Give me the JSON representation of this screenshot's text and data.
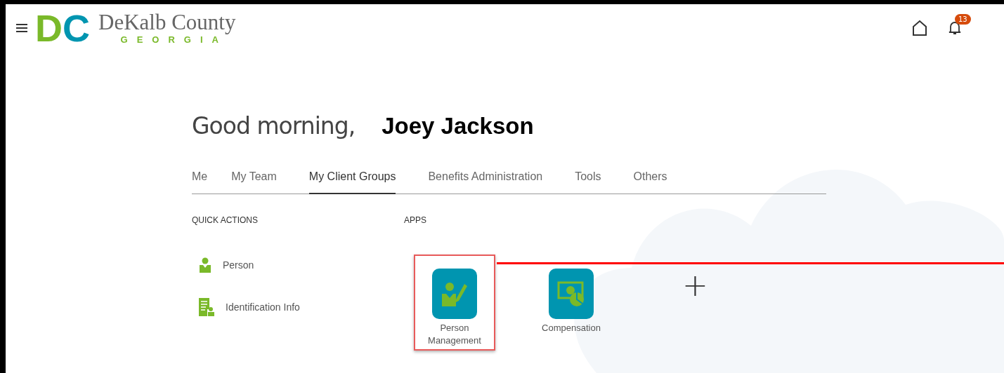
{
  "header": {
    "logo_mark": [
      "D",
      "C"
    ],
    "logo_name": "DeKalb County",
    "logo_sub": "GEORGIA",
    "notification_count": "13"
  },
  "greeting": {
    "text": "Good morning,",
    "name": "Joey Jackson"
  },
  "tabs": [
    {
      "label": "Me",
      "selected": false
    },
    {
      "label": "My Team",
      "selected": false
    },
    {
      "label": "My Client Groups",
      "selected": true
    },
    {
      "label": "Benefits Administration",
      "selected": false
    },
    {
      "label": "Tools",
      "selected": false
    },
    {
      "label": "Others",
      "selected": false
    }
  ],
  "quick_actions": {
    "title": "QUICK ACTIONS",
    "items": [
      {
        "label": "Person",
        "kind": "person"
      },
      {
        "label": "Identification Info",
        "kind": "document"
      }
    ]
  },
  "apps": {
    "title": "APPS",
    "items": [
      {
        "label": "Person Management",
        "kind": "person-edit",
        "highlighted": true
      },
      {
        "label": "Compensation",
        "kind": "money",
        "highlighted": false
      }
    ],
    "add": "+"
  }
}
